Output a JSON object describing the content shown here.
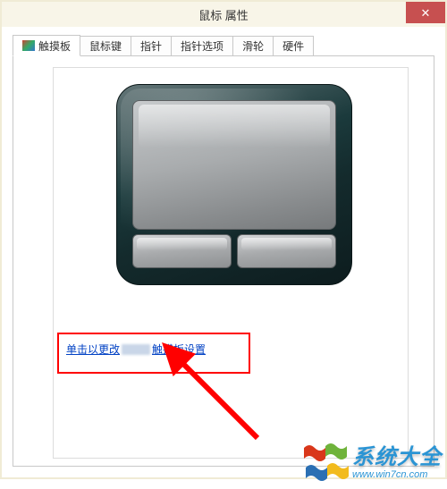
{
  "window": {
    "title": "鼠标 属性",
    "close_icon": "✕"
  },
  "tabs": [
    {
      "label": "触摸板"
    },
    {
      "label": "鼠标键"
    },
    {
      "label": "指针"
    },
    {
      "label": "指针选项"
    },
    {
      "label": "滑轮"
    },
    {
      "label": "硬件"
    }
  ],
  "content": {
    "link_part1": "单击以更改",
    "link_part2": "触摸板设置"
  },
  "watermark": {
    "main": "系统大全",
    "sub": "www.win7cn.com"
  }
}
